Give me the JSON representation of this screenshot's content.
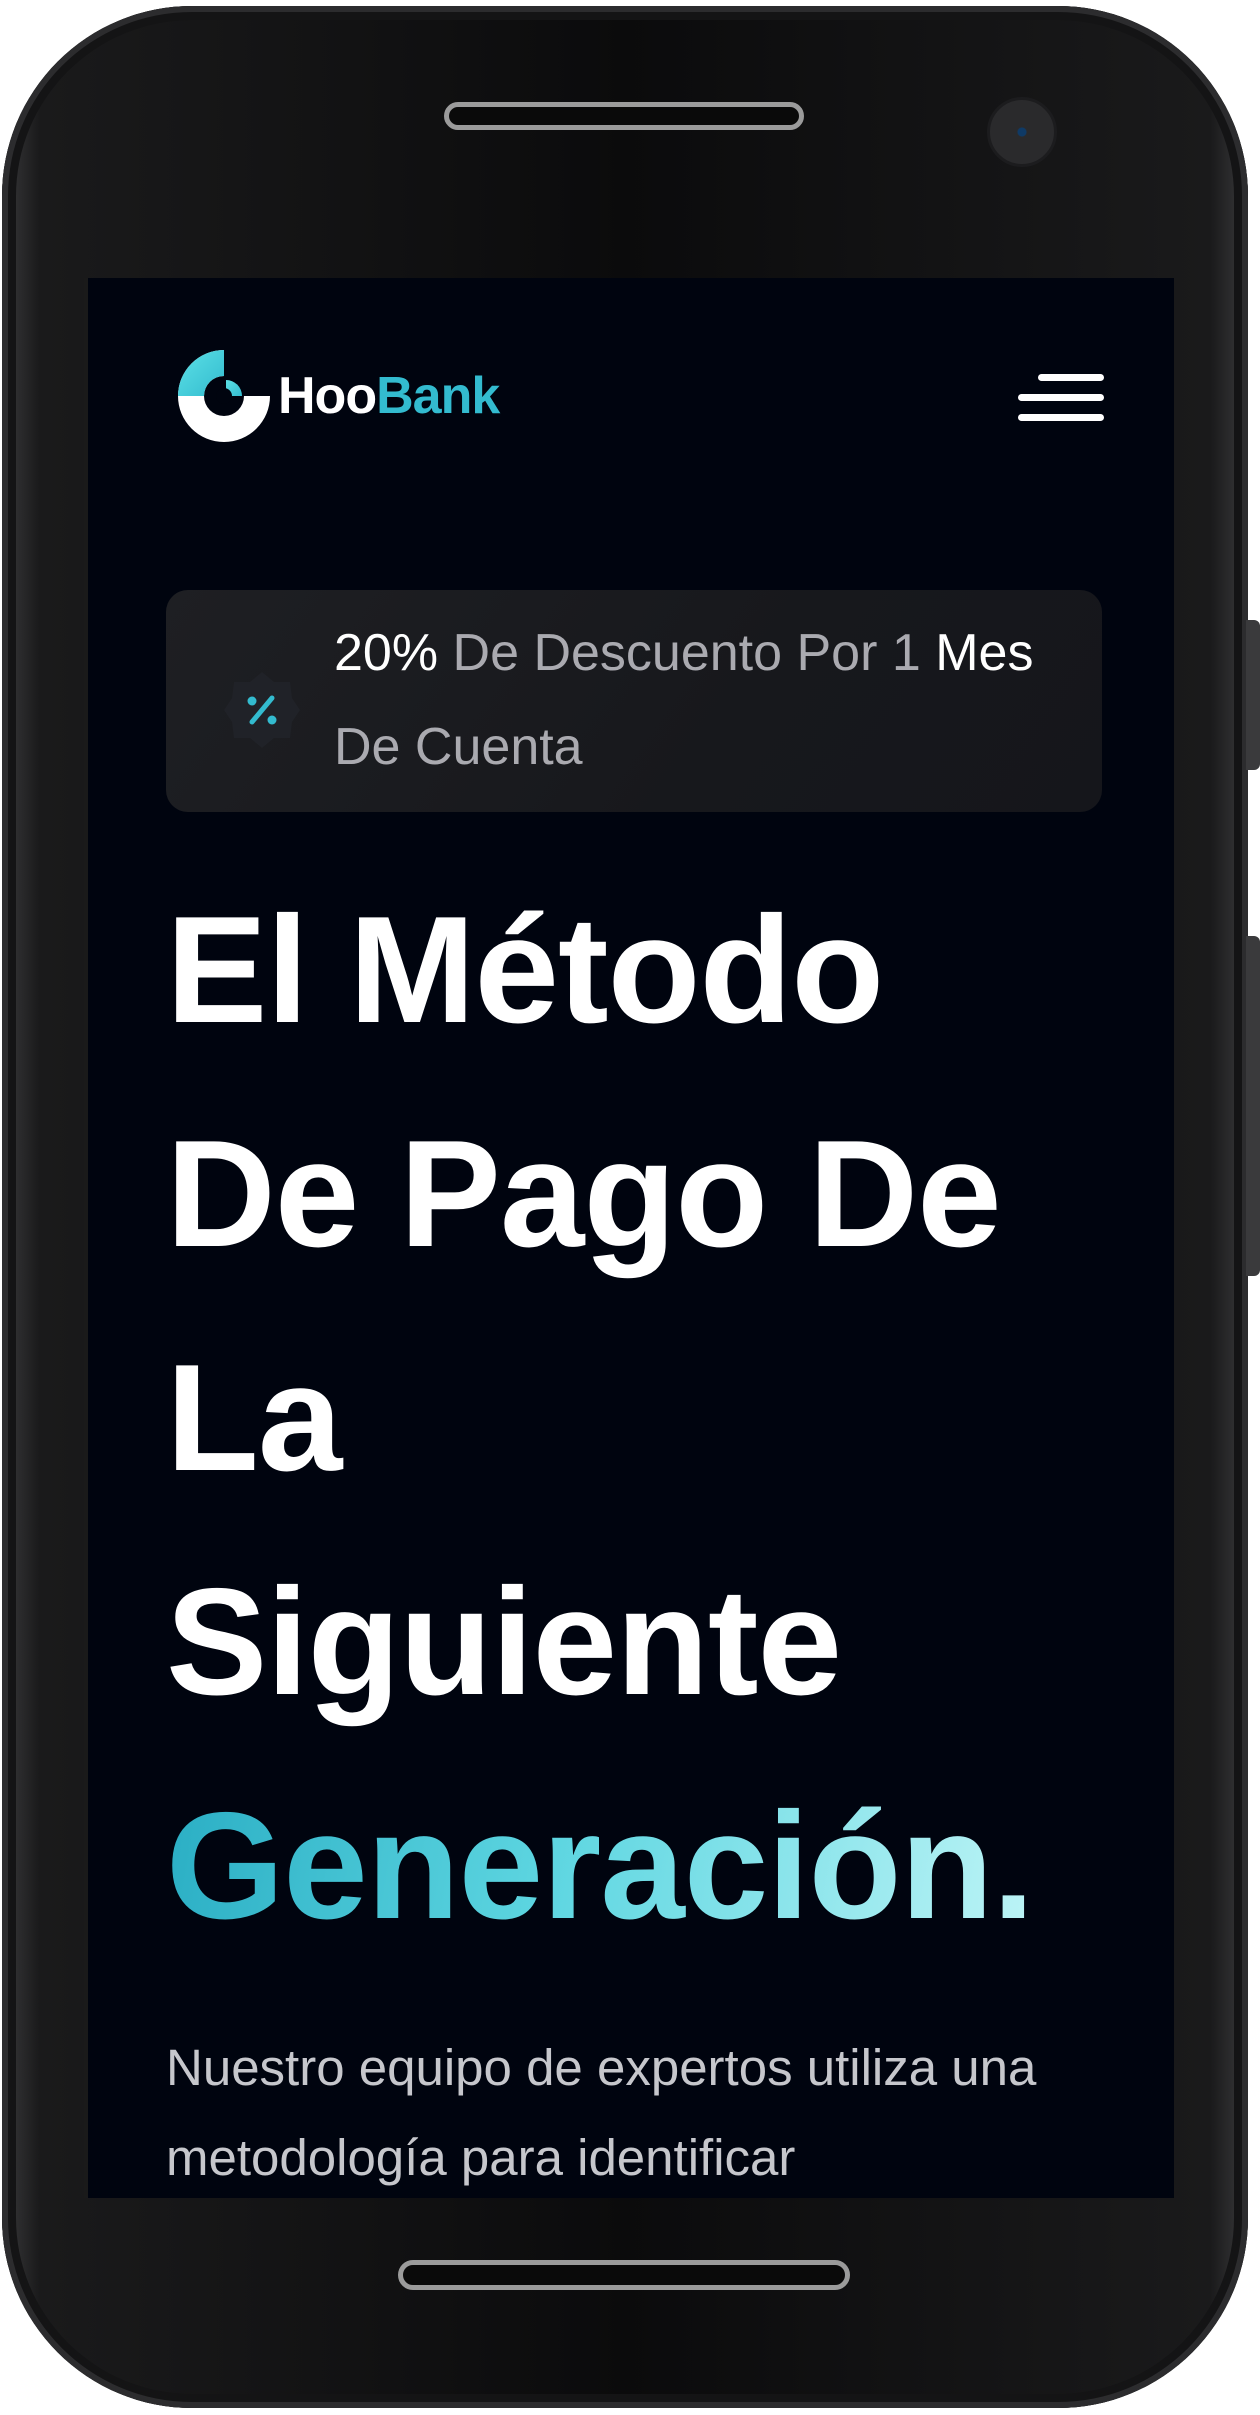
{
  "brand": {
    "logo_first": "Hoo",
    "logo_second": "Bank",
    "accent_color": "#33bbcf"
  },
  "nav": {
    "menu_icon": "hamburger-menu-icon"
  },
  "promo": {
    "icon": "discount-percent-icon",
    "highlight_1": "20%",
    "text_1": " De Descuento Por 1 ",
    "highlight_2": "Mes",
    "text_2": " De Cuenta"
  },
  "hero": {
    "title_line_1": "El Método",
    "title_line_2": "De Pago De",
    "title_line_3": "La",
    "title_line_4": "Siguiente",
    "title_highlight": "Generación.",
    "description": "Nuestro equipo de expertos utiliza una metodología para identificar"
  }
}
